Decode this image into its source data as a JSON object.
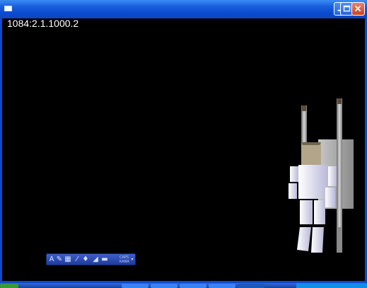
{
  "window": {
    "title": "",
    "buttons": [
      "minimize",
      "maximize",
      "close"
    ]
  },
  "viewport": {
    "overlay_text": "1084:2.1.1000.2"
  },
  "palette": {
    "items": [
      {
        "icon": "text-tool-icon",
        "glyph": "A"
      },
      {
        "icon": "brush-tool-icon",
        "glyph": "✎"
      },
      {
        "icon": "image-tool-icon",
        "glyph": "▦"
      },
      {
        "icon": "wand-tool-icon",
        "glyph": "⁄"
      },
      {
        "icon": "pin-tool-icon",
        "glyph": "♦"
      },
      {
        "icon": "box-tool-icon",
        "glyph": "◢"
      },
      {
        "icon": "screen-tool-icon",
        "glyph": "▬"
      }
    ],
    "label_top": "CAPS",
    "label_bottom": "KANA"
  },
  "taskbar": {
    "items": [
      "",
      "",
      "",
      "",
      "",
      "",
      ""
    ]
  }
}
